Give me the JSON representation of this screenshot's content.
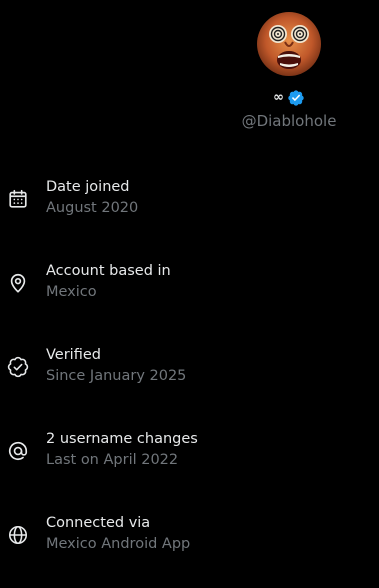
{
  "profile": {
    "display_name": "∞",
    "handle": "@Diablohole"
  },
  "colors": {
    "background": "#000000",
    "primary_text": "#e7e9ea",
    "secondary_text": "#71767b",
    "verified_blue": "#1d9bf0"
  },
  "info_items": [
    {
      "icon": "calendar-icon",
      "title": "Date joined",
      "subtitle": "August 2020"
    },
    {
      "icon": "location-pin-icon",
      "title": "Account based in",
      "subtitle": "Mexico"
    },
    {
      "icon": "verified-check-icon",
      "title": "Verified",
      "subtitle": "Since January 2025"
    },
    {
      "icon": "at-sign-icon",
      "title": "2 username changes",
      "subtitle": "Last on April 2022"
    },
    {
      "icon": "globe-icon",
      "title": "Connected via",
      "subtitle": "Mexico Android App"
    }
  ]
}
